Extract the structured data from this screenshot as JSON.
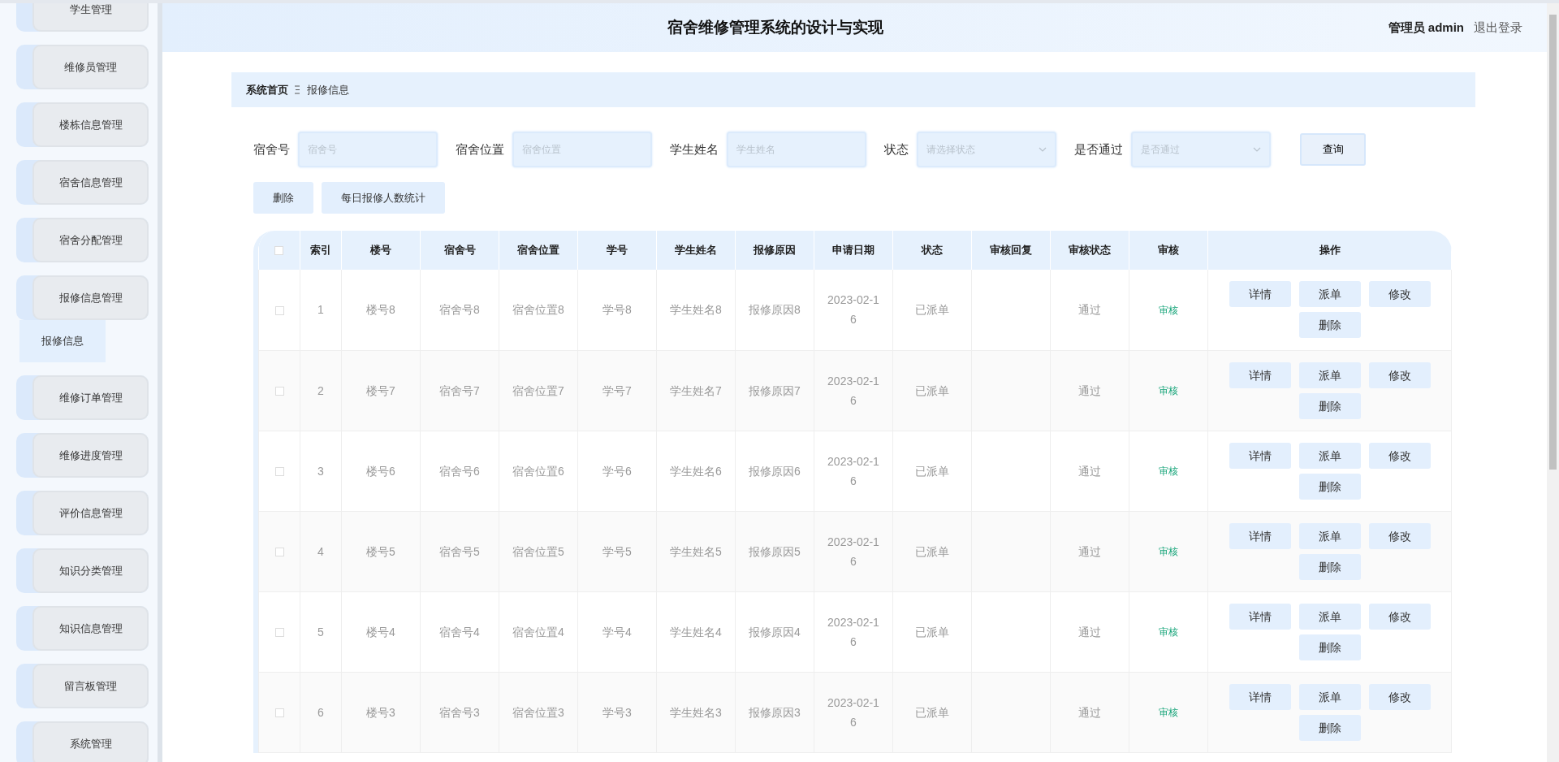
{
  "header": {
    "title": "宿舍维修管理系统的设计与实现",
    "user_role": "管理员",
    "username": "admin",
    "logout": "退出登录"
  },
  "sidebar": {
    "items": [
      {
        "label": "学生管理",
        "selected": false
      },
      {
        "label": "维修员管理",
        "selected": false
      },
      {
        "label": "楼栋信息管理",
        "selected": false
      },
      {
        "label": "宿舍信息管理",
        "selected": false
      },
      {
        "label": "宿舍分配管理",
        "selected": false
      },
      {
        "label": "报修信息管理",
        "selected": false,
        "children": [
          {
            "label": "报修信息",
            "selected": true
          }
        ]
      },
      {
        "label": "维修订单管理",
        "selected": false
      },
      {
        "label": "维修进度管理",
        "selected": false
      },
      {
        "label": "评价信息管理",
        "selected": false
      },
      {
        "label": "知识分类管理",
        "selected": false
      },
      {
        "label": "知识信息管理",
        "selected": false
      },
      {
        "label": "留言板管理",
        "selected": false
      },
      {
        "label": "系统管理",
        "selected": false
      }
    ]
  },
  "breadcrumb": [
    {
      "label": "系统首页"
    },
    {
      "label": "报修信息"
    }
  ],
  "search": {
    "fields": [
      {
        "kind": "input",
        "label": "宿舍号",
        "placeholder": "宿舍号"
      },
      {
        "kind": "input",
        "label": "宿舍位置",
        "placeholder": "宿舍位置"
      },
      {
        "kind": "input",
        "label": "学生姓名",
        "placeholder": "学生姓名"
      },
      {
        "kind": "select",
        "label": "状态",
        "placeholder": "请选择状态"
      },
      {
        "kind": "select",
        "label": "是否通过",
        "placeholder": "是否通过"
      }
    ],
    "button": "查询"
  },
  "actions": [
    "删除",
    "每日报修人数统计"
  ],
  "table": {
    "select_all_checked": false,
    "columns": [
      "索引",
      "楼号",
      "宿舍号",
      "宿舍位置",
      "学号",
      "学生姓名",
      "报修原因",
      "申请日期",
      "状态",
      "审核回复",
      "审核状态",
      "审核",
      "操作"
    ],
    "rows": [
      {
        "checked": false,
        "index": "1",
        "building": "楼号8",
        "dorm": "宿舍号8",
        "location": "宿舍位置8",
        "student_no": "学号8",
        "student_name": "学生姓名8",
        "reason": "报修原因8",
        "date": "2023-02-16",
        "status": "已派单",
        "review_status": "通过",
        "review_link": "审核",
        "buttons": [
          "详情",
          "派单",
          "修改",
          "删除"
        ]
      },
      {
        "checked": false,
        "index": "2",
        "building": "楼号7",
        "dorm": "宿舍号7",
        "location": "宿舍位置7",
        "student_no": "学号7",
        "student_name": "学生姓名7",
        "reason": "报修原因7",
        "date": "2023-02-16",
        "status": "已派单",
        "review_status": "通过",
        "review_link": "审核",
        "buttons": [
          "详情",
          "派单",
          "修改",
          "删除"
        ]
      },
      {
        "checked": false,
        "index": "3",
        "building": "楼号6",
        "dorm": "宿舍号6",
        "location": "宿舍位置6",
        "student_no": "学号6",
        "student_name": "学生姓名6",
        "reason": "报修原因6",
        "date": "2023-02-16",
        "status": "已派单",
        "review_status": "通过",
        "review_link": "审核",
        "buttons": [
          "详情",
          "派单",
          "修改",
          "删除"
        ]
      },
      {
        "checked": false,
        "index": "4",
        "building": "楼号5",
        "dorm": "宿舍号5",
        "location": "宿舍位置5",
        "student_no": "学号5",
        "student_name": "学生姓名5",
        "reason": "报修原因5",
        "date": "2023-02-16",
        "status": "已派单",
        "review_status": "通过",
        "review_link": "审核",
        "buttons": [
          "详情",
          "派单",
          "修改",
          "删除"
        ]
      },
      {
        "checked": false,
        "index": "5",
        "building": "楼号4",
        "dorm": "宿舍号4",
        "location": "宿舍位置4",
        "student_no": "学号4",
        "student_name": "学生姓名4",
        "reason": "报修原因4",
        "date": "2023-02-16",
        "status": "已派单",
        "review_status": "通过",
        "review_link": "审核",
        "buttons": [
          "详情",
          "派单",
          "修改",
          "删除"
        ]
      },
      {
        "checked": false,
        "index": "6",
        "building": "楼号3",
        "dorm": "宿舍号3",
        "location": "宿舍位置3",
        "student_no": "学号3",
        "student_name": "学生姓名3",
        "reason": "报修原因3",
        "date": "2023-02-16",
        "status": "已派单",
        "review_status": "通过",
        "review_link": "审核",
        "buttons": [
          "详情",
          "派单",
          "修改",
          "删除"
        ]
      }
    ]
  }
}
